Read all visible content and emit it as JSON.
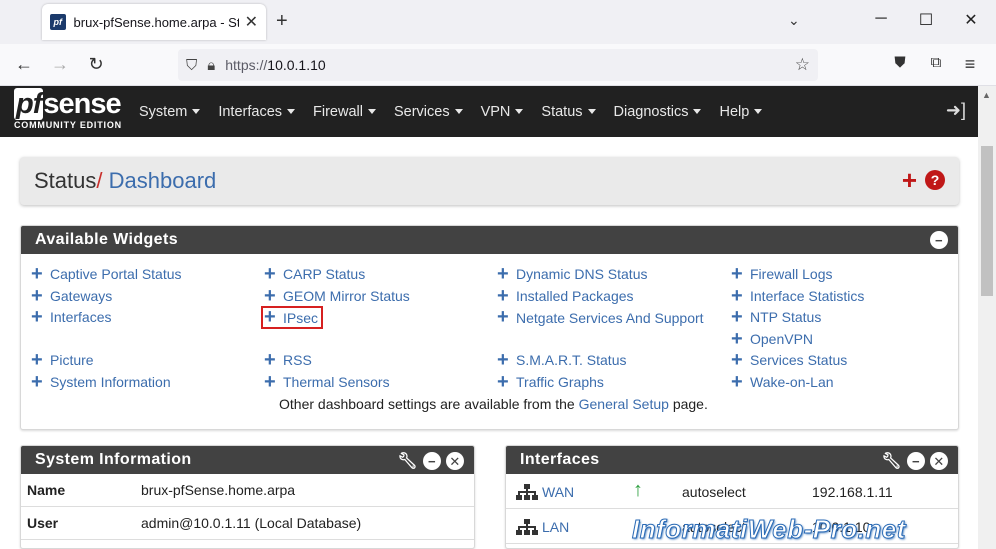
{
  "browser": {
    "tab_title": "brux-pfSense.home.arpa - Status",
    "url_prefix": "https://",
    "url_host": "10.0.1.10"
  },
  "header": {
    "logo_pf": "pf",
    "logo_sense": "sense",
    "logo_sub": "COMMUNITY EDITION",
    "menu": [
      "System",
      "Interfaces",
      "Firewall",
      "Services",
      "VPN",
      "Status",
      "Diagnostics",
      "Help"
    ]
  },
  "breadcrumb": {
    "root": "Status",
    "sep": "/",
    "current": "Dashboard"
  },
  "available_widgets": {
    "title": "Available Widgets",
    "col1": [
      "Captive Portal Status",
      "Gateways",
      "Interfaces",
      "",
      "Picture",
      "System Information"
    ],
    "col2": [
      "CARP Status",
      "GEOM Mirror Status",
      "IPsec",
      "",
      "RSS",
      "Thermal Sensors"
    ],
    "col3a": [
      "Dynamic DNS Status",
      "Installed Packages"
    ],
    "col3_wrap": "Netgate Services And Support",
    "col3b": [
      "S.M.A.R.T. Status",
      "Traffic Graphs"
    ],
    "col4": [
      "Firewall Logs",
      "Interface Statistics",
      "NTP Status",
      "OpenVPN",
      "Services Status",
      "Wake-on-Lan"
    ],
    "note_pre": "Other dashboard settings are available from the",
    "note_link": "General Setup",
    "note_post": "page."
  },
  "system_information": {
    "title": "System Information",
    "rows": [
      {
        "key": "Name",
        "value": "brux-pfSense.home.arpa"
      },
      {
        "key": "User",
        "value": "admin@10.0.1.11 (Local Database)"
      }
    ]
  },
  "interfaces": {
    "title": "Interfaces",
    "rows": [
      {
        "name": "WAN",
        "media": "autoselect",
        "address": "192.168.1.11"
      },
      {
        "name": "LAN",
        "media": "autoselect",
        "address": "10.0.1.10"
      }
    ]
  },
  "watermark": "InformatiWeb-Pro.net"
}
